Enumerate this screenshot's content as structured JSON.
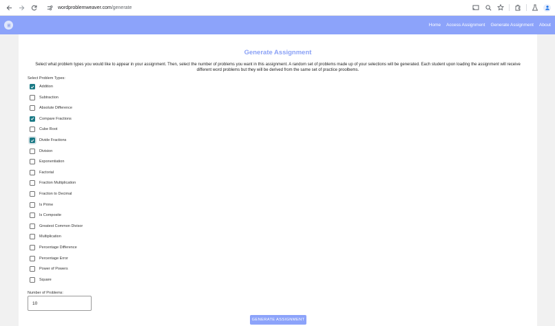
{
  "browser": {
    "url_host": "wordproblemweaver.com",
    "url_path": "/generate",
    "icons": [
      "back-icon",
      "forward-icon",
      "reload-icon",
      "site-settings-icon",
      "cast-icon",
      "zoom-icon",
      "bookmark-star-icon",
      "extensions-icon",
      "labs-icon",
      "profile-icon"
    ]
  },
  "header": {
    "nav": [
      "Home",
      "Access Assignment",
      "Generate Assignment",
      "About"
    ],
    "color": "#8ca3fa"
  },
  "page": {
    "title": "Generate Assignment",
    "intro": "Select what problem types you would like to appear in your assignment. Then, select the number of problems you want in this assignment. A random set of problems made up of your selections will be generated. Each student upon loading the assignment will receive different word problems but they will be derived from the same set of practice proolbems.",
    "select_label": "Select Problem Types:",
    "problem_types": [
      {
        "label": "Addition",
        "checked": true
      },
      {
        "label": "Subtraction",
        "checked": false
      },
      {
        "label": "Absolute Difference",
        "checked": false
      },
      {
        "label": "Compare Fractions",
        "checked": true
      },
      {
        "label": "Cube Root",
        "checked": false
      },
      {
        "label": "Divide Fractions",
        "checked": true
      },
      {
        "label": "Division",
        "checked": false
      },
      {
        "label": "Exponentiation",
        "checked": false
      },
      {
        "label": "Factorial",
        "checked": false
      },
      {
        "label": "Fraction Multiplication",
        "checked": false
      },
      {
        "label": "Fraction to Decimal",
        "checked": false
      },
      {
        "label": "Is Prime",
        "checked": false
      },
      {
        "label": "Is Composite",
        "checked": false
      },
      {
        "label": "Greatest Common Divisor",
        "checked": false
      },
      {
        "label": "Multiplication",
        "checked": false
      },
      {
        "label": "Percentage Difference",
        "checked": false
      },
      {
        "label": "Percentage Error",
        "checked": false
      },
      {
        "label": "Power of Powers",
        "checked": false
      },
      {
        "label": "Square",
        "checked": false
      }
    ],
    "num_label": "Number of Problems:",
    "num_value": "10",
    "generate_label": "GENERATE ASSIGNMENT",
    "accent": "#1b7a86"
  }
}
